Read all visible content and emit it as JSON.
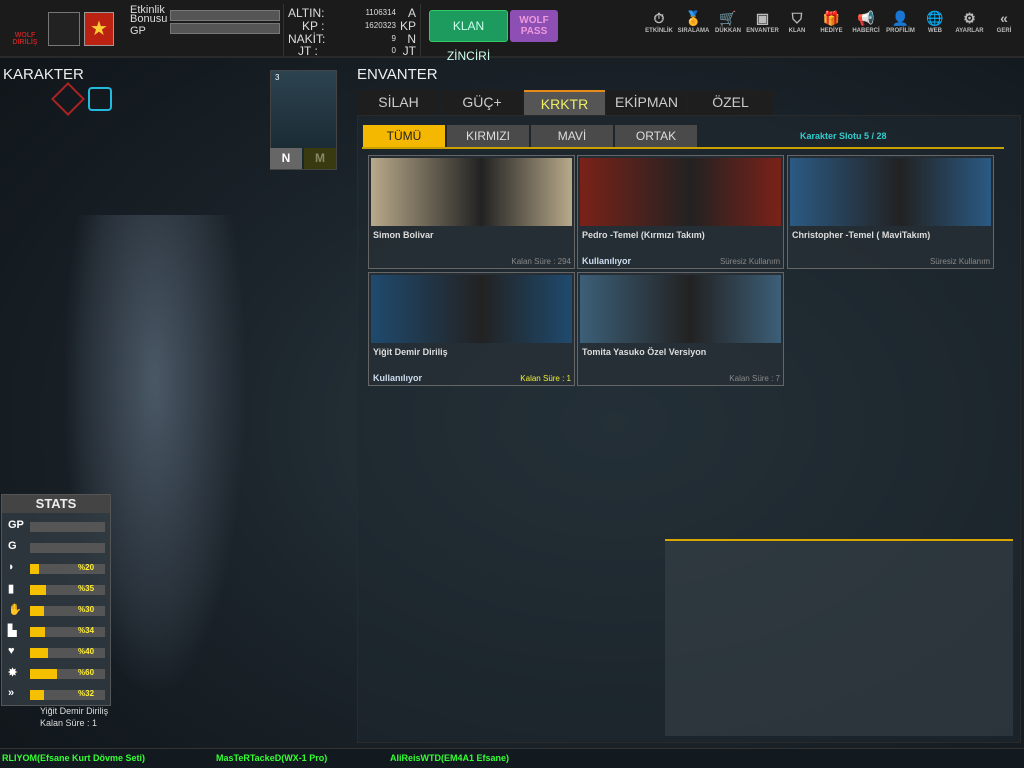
{
  "header": {
    "logo_text": "WOLF DİRİLİŞ",
    "bonus_label_1": "Etkinlik",
    "bonus_label_2": "Bonusu",
    "gp_label": "GP",
    "currencies": [
      {
        "label": "ALTIN:",
        "value": "1106314",
        "unit": "A"
      },
      {
        "label": "KP :",
        "value": "1620323",
        "unit": "KP"
      },
      {
        "label": "NAKİT:",
        "value": "9",
        "unit": "N"
      },
      {
        "label": "JT :",
        "value": "0",
        "unit": "JT"
      }
    ],
    "klan_button": "KLAN ZİNCİRİ",
    "wolf_pass_1": "WOLF",
    "wolf_pass_2": "PASS",
    "nav": [
      {
        "label": "ETKİNLİK",
        "icon": "stopwatch-icon",
        "glyph": "⏱"
      },
      {
        "label": "SIRALAMA",
        "icon": "medal-icon",
        "glyph": "🏅"
      },
      {
        "label": "DÜKKAN",
        "icon": "cart-icon",
        "glyph": "🛒"
      },
      {
        "label": "ENVANTER",
        "icon": "chest-icon",
        "glyph": "▣"
      },
      {
        "label": "KLAN",
        "icon": "shield-icon",
        "glyph": "⛉"
      },
      {
        "label": "HEDİYE",
        "icon": "gift-icon",
        "glyph": "🎁"
      },
      {
        "label": "HABERCİ",
        "icon": "megaphone-icon",
        "glyph": "📢"
      },
      {
        "label": "PROFİLİM",
        "icon": "profile-icon",
        "glyph": "👤"
      },
      {
        "label": "WEB",
        "icon": "globe-icon",
        "glyph": "🌐"
      },
      {
        "label": "AYARLAR",
        "icon": "gear-icon",
        "glyph": "⚙"
      },
      {
        "label": "GERİ",
        "icon": "back-icon",
        "glyph": "«"
      }
    ]
  },
  "karakter": {
    "title": "KARAKTER",
    "mini_card_level": "3",
    "n_label": "N",
    "m_label": "M",
    "char_name": "Yiğit Demir Diriliş",
    "char_time": "Kalan Süre : 1"
  },
  "envanter": {
    "title": "ENVANTER",
    "tabs": [
      "SİLAH",
      "GÜÇ+",
      "KRKTR",
      "EKİPMAN",
      "ÖZEL"
    ],
    "active_tab": "KRKTR",
    "sub_tabs": [
      "TÜMÜ",
      "KIRMIZI",
      "MAVİ",
      "ORTAK"
    ],
    "active_sub": "TÜMÜ",
    "slot_text": "Karakter Slotu 5 / 28",
    "items": [
      {
        "name": "Simon Bolivar",
        "status": "",
        "time": "Kalan Süre : 294",
        "color": "#b8a98a"
      },
      {
        "name": "Pedro -Temel (Kırmızı Takım)",
        "status": "Kullanılıyor",
        "time": "Süresiz Kullanım",
        "color": "#7a2218"
      },
      {
        "name": "Christopher -Temel ( MaviTakım)",
        "status": "",
        "time": "Süresiz Kullanım",
        "color": "#2b5a84"
      },
      {
        "name": "Yiğit Demir Diriliş",
        "status": "Kullanılıyor",
        "time": "Kalan Süre : 1",
        "color": "#1f4a6e"
      },
      {
        "name": "Tomita Yasuko Özel Versiyon",
        "status": "",
        "time": "Kalan Süre : 7",
        "color": "#3c5f78"
      }
    ]
  },
  "stats": {
    "title": "STATS",
    "rows": [
      {
        "icon": "GP",
        "pct": null
      },
      {
        "icon": "G",
        "pct": null
      },
      {
        "icon": "helmet-icon",
        "glyph": "◗",
        "pct": 20,
        "label": "%20"
      },
      {
        "icon": "vest-icon",
        "glyph": "▮",
        "pct": 35,
        "label": "%35"
      },
      {
        "icon": "glove-icon",
        "glyph": "✋",
        "pct": 30,
        "label": "%30"
      },
      {
        "icon": "boot-icon",
        "glyph": "▙",
        "pct": 34,
        "label": "%34"
      },
      {
        "icon": "heart-icon",
        "glyph": "♥",
        "pct": 40,
        "label": "%40"
      },
      {
        "icon": "burst-icon",
        "glyph": "✸",
        "pct": 60,
        "label": "%60"
      },
      {
        "icon": "speed-icon",
        "glyph": "»",
        "pct": 32,
        "label": "%32"
      }
    ]
  },
  "ticker": [
    "RLIYOM(Efsane Kurt Dövme Seti)",
    "MasTeRTackeD(WX-1 Pro)",
    "AliReisWTD(EM4A1 Efsane)"
  ]
}
